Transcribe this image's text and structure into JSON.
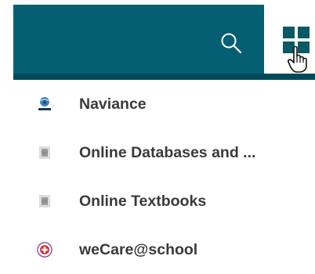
{
  "header": {
    "search_icon": "search-icon",
    "apps_icon": "grid-icon",
    "cursor_icon": "hand-pointer-icon",
    "colors": {
      "bar": "#045f72",
      "rule": "#024a5a",
      "grid": "#0a5a66"
    }
  },
  "menu": {
    "items": [
      {
        "label": "Naviance",
        "icon": "naviance-logo-icon"
      },
      {
        "label": "Online Databases and ...",
        "icon": "placeholder-icon"
      },
      {
        "label": "Online Textbooks",
        "icon": "placeholder-icon"
      },
      {
        "label": "weCare@school",
        "icon": "medical-cross-icon"
      }
    ]
  }
}
